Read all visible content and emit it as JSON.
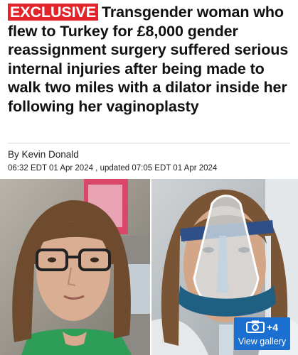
{
  "article": {
    "badge": "EXCLUSIVE",
    "headline": "Transgender woman who flew to Turkey for £8,000 gender reassignment surgery suffered serious internal injuries after being made to walk two miles with a dilator inside her following her vaginoplasty",
    "byline": "By Kevin Donald",
    "dateline": "06:32 EDT 01 Apr 2024 , updated 07:05 EDT 01 Apr 2024"
  },
  "gallery": {
    "count": "+4",
    "label": "View gallery"
  },
  "colors": {
    "badge_bg": "#e3242b",
    "gallery_bg": "#1a6fd1"
  }
}
